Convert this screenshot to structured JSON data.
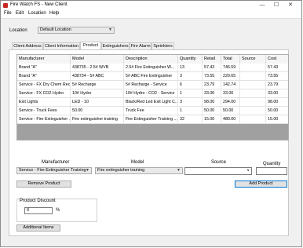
{
  "window": {
    "title": "Fire Watch FS - New Client",
    "minimize": "—",
    "maximize": "☐",
    "close": "✕"
  },
  "menu": [
    "File",
    "Edit",
    "Location",
    "Help"
  ],
  "location": {
    "label": "Location",
    "value": "Default Location"
  },
  "tabs": [
    "Client Address",
    "Client Information",
    "Product",
    "Extinguishers",
    "Fire Alarm",
    "Sprinklers"
  ],
  "active_tab": "Product",
  "grid": {
    "columns": [
      "Manufacturer",
      "Model",
      "Description",
      "Quantity",
      "Retail",
      "Total",
      "Source",
      "Cost"
    ],
    "rows": [
      [
        "Brand \"A\"",
        "438735 - 2.5# WVB",
        "2.5# Fire Extinguisher W...",
        "13",
        "57.43",
        "746.59",
        "",
        "57.43"
      ],
      [
        "Brand \"A\"",
        "438734 - 5# ABC",
        "5# ABC Fire Extinguisher",
        "3",
        "73.55",
        "220.65",
        "",
        "73.55"
      ],
      [
        "Service - FX Dry Chem Rec...",
        "5# Recharge",
        "5# Recharge  - Service",
        "6",
        "23.79",
        "142.74",
        "",
        "23.79"
      ],
      [
        "Service - FX CO2 Hydro",
        "10# Hydro",
        "10# Hydro - CO2 - Service",
        "1",
        "33.00",
        "33.00",
        "",
        "33.00"
      ],
      [
        "Exit Lights",
        "LED - 10",
        "Black/Red Led Exit Light C...",
        "3",
        "98.00",
        "294.00",
        "",
        "98.00"
      ],
      [
        "Service - Truck Fees",
        "50.00",
        "Truck Fee",
        "1",
        "50.00",
        "50.00",
        "",
        "50.00"
      ],
      [
        "Service - Fire Extinguisher ...",
        "Fire extinguisher training",
        "Fire Extinguisher Training ...",
        "32",
        "15.00",
        "480.00",
        "",
        "15.00"
      ]
    ]
  },
  "form": {
    "manufacturer_label": "Manufacturer",
    "model_label": "Model",
    "source_label": "Source",
    "quantity_label": "Quantity",
    "manufacturer_value": "Service - Fire Extinguisher Training",
    "model_value": "Fire extinguisher training",
    "source_value": "",
    "quantity_value": "",
    "remove_button": "Remove Product",
    "add_button": "Add Product"
  },
  "discount": {
    "label": "Product Discount",
    "value": "0",
    "unit": "%"
  },
  "additional_button": "Additional Items"
}
